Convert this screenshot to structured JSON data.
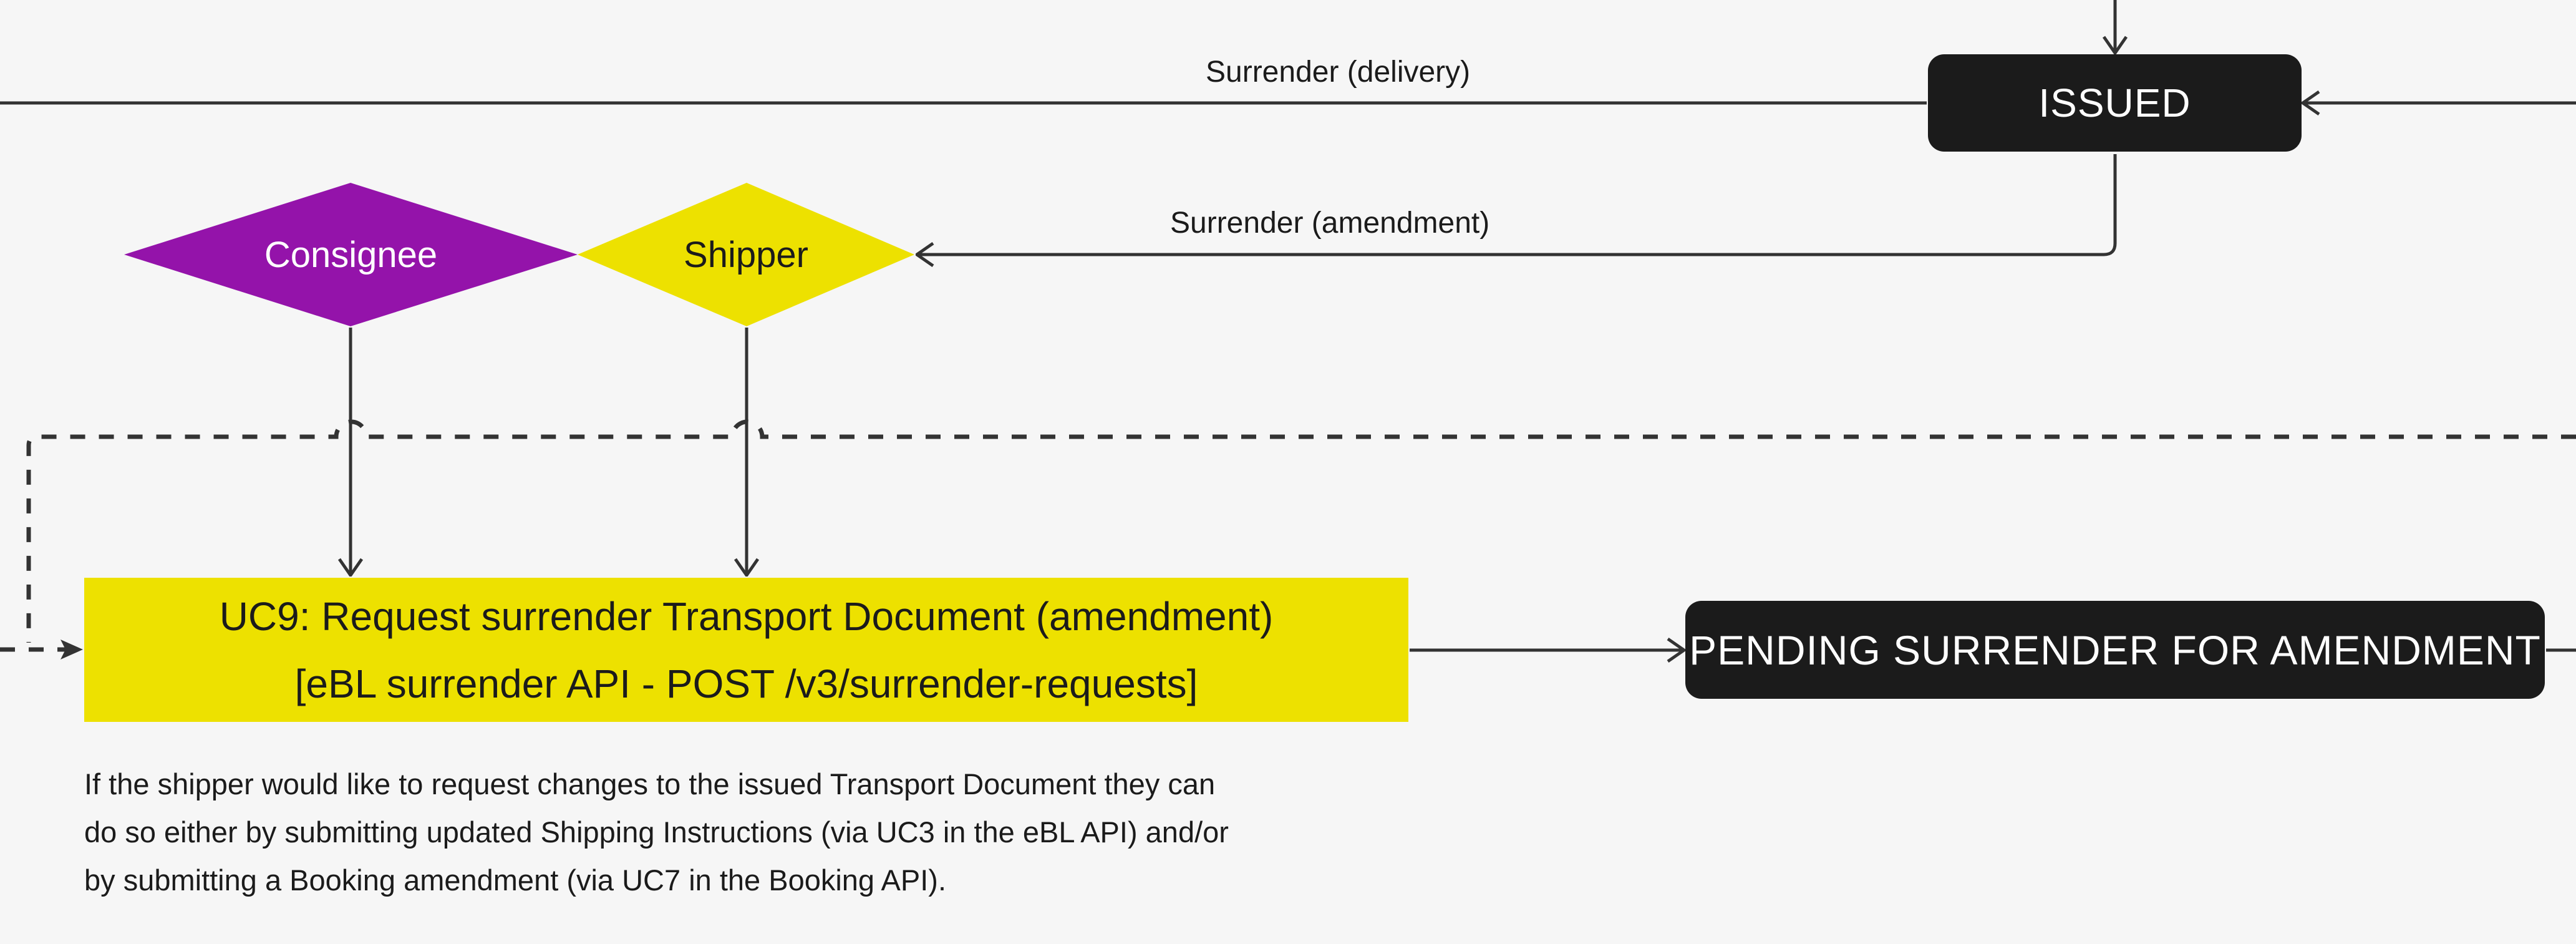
{
  "diagram": {
    "colors": {
      "background": "#f6f6f6",
      "state_fill": "#1b1b1b",
      "state_text": "#ffffff",
      "consignee_fill": "#9413aa",
      "shipper_fill": "#ede100",
      "usecase_fill": "#ede100",
      "line": "#333333"
    },
    "states": {
      "issued": "ISSUED",
      "pending": "PENDING SURRENDER FOR AMENDMENT"
    },
    "actors": {
      "consignee": "Consignee",
      "shipper": "Shipper"
    },
    "edge_labels": {
      "delivery": "Surrender (delivery)",
      "amendment": "Surrender (amendment)"
    },
    "usecase": {
      "title": "UC9: Request surrender Transport Document (amendment)",
      "api": "[eBL surrender API - POST /v3/surrender-requests]"
    },
    "description": [
      "If the shipper would like to request changes to the issued Transport Document they can",
      "do so either by submitting updated Shipping Instructions (via UC3 in the eBL API) and/or",
      "by submitting a Booking amendment (via UC7 in the Booking API)."
    ]
  }
}
